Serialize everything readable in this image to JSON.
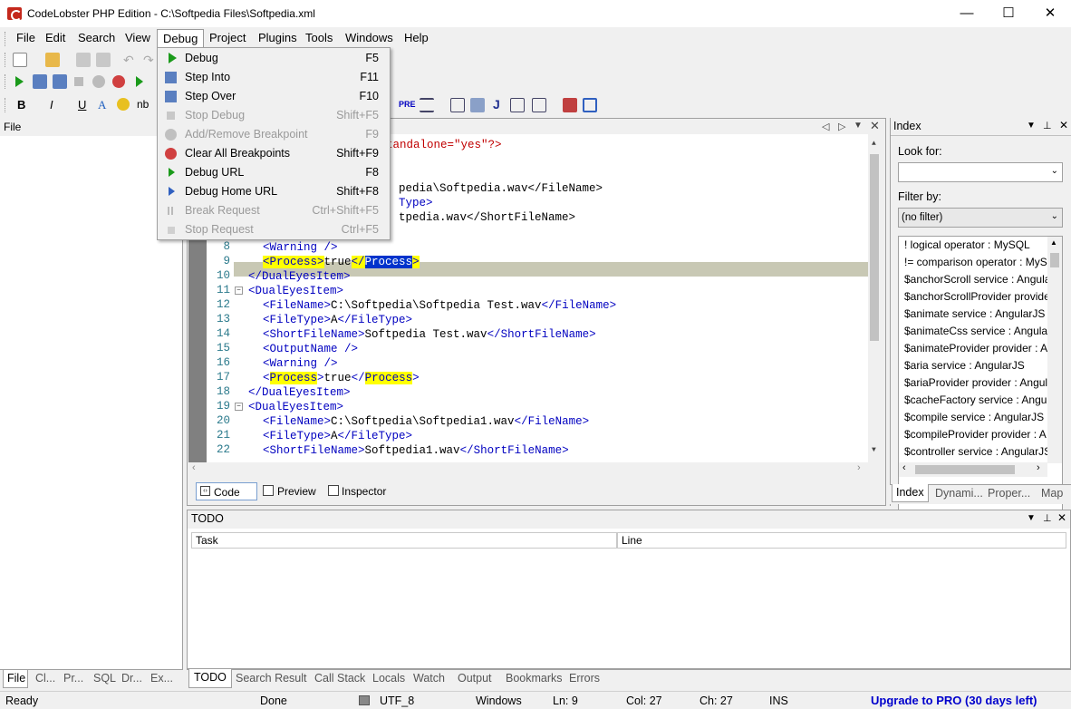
{
  "window": {
    "title": "CodeLobster PHP Edition - C:\\Softpedia Files\\Softpedia.xml",
    "min": "—",
    "max": "☐",
    "close": "✕"
  },
  "menubar": [
    "File",
    "Edit",
    "Search",
    "View",
    "Debug",
    "Project",
    "Plugins",
    "Tools",
    "Windows",
    "Help"
  ],
  "debug_menu": [
    {
      "label": "Debug",
      "key": "F5",
      "enabled": true
    },
    {
      "label": "Step Into",
      "key": "F11",
      "enabled": true
    },
    {
      "label": "Step Over",
      "key": "F10",
      "enabled": true
    },
    {
      "label": "Stop Debug",
      "key": "Shift+F5",
      "enabled": false
    },
    {
      "label": "Add/Remove Breakpoint",
      "key": "F9",
      "enabled": false
    },
    {
      "label": "Clear All Breakpoints",
      "key": "Shift+F9",
      "enabled": true
    },
    {
      "label": "Debug URL",
      "key": "F8",
      "enabled": true
    },
    {
      "label": "Debug Home URL",
      "key": "Shift+F8",
      "enabled": true
    },
    {
      "label": "Break Request",
      "key": "Ctrl+Shift+F5",
      "enabled": false
    },
    {
      "label": "Stop Request",
      "key": "Ctrl+F5",
      "enabled": false
    }
  ],
  "format_toolbar": {
    "bold": "B",
    "italic": "I",
    "underline": "U",
    "font": "A",
    "nb": "nb",
    "pre": "PRE",
    "j": "J"
  },
  "file_panel": {
    "title": "File"
  },
  "left_tabs": [
    "File",
    "Cl...",
    "Pr...",
    "SQL",
    "Dr...",
    "Ex..."
  ],
  "editor": {
    "line_numbers": [
      "8",
      "9",
      "10",
      "11",
      "12",
      "13",
      "14",
      "15",
      "16",
      "17",
      "18",
      "19",
      "20",
      "21",
      "22"
    ],
    "partial_top": [
      "tandalone=\"yes\"?>",
      "",
      "pedia\\Softpedia.wav</FileName>",
      "Type>",
      "tpedia.wav</ShortFileName>"
    ],
    "tabs": {
      "code": "Code",
      "preview": "Preview",
      "inspector": "Inspector"
    }
  },
  "index_panel": {
    "title": "Index",
    "look_for": "Look for:",
    "filter_by": "Filter by:",
    "filter_value": "(no filter)",
    "items": [
      "! logical operator : MySQL",
      "!= comparison operator : MyS",
      "$anchorScroll service : Angula",
      "$anchorScrollProvider provide",
      "$animate service : AngularJS",
      "$animateCss service : Angular",
      "$animateProvider provider : A",
      "$aria service : AngularJS",
      "$ariaProvider provider : Angul",
      "$cacheFactory service : Angul",
      "$compile service : AngularJS",
      "$compileProvider provider : A",
      "$controller service : AngularJS"
    ],
    "tabs": [
      "Index",
      "Dynami...",
      "Proper...",
      "Map"
    ]
  },
  "todo_panel": {
    "title": "TODO",
    "col_task": "Task",
    "col_line": "Line"
  },
  "bottom_tabs": [
    "TODO",
    "Search Result",
    "Call Stack",
    "Locals",
    "Watch",
    "Output",
    "Bookmarks",
    "Errors"
  ],
  "status": {
    "ready": "Ready",
    "done": "Done",
    "encoding": "UTF_8",
    "eol": "Windows",
    "line": "Ln: 9",
    "col": "Col: 27",
    "ch": "Ch: 27",
    "mode": "INS",
    "upgrade": "Upgrade to PRO (30 days left)"
  },
  "colors": {
    "accent": "#0000c0",
    "highlight": "#ffff00",
    "upgrade": "#0000cc"
  }
}
